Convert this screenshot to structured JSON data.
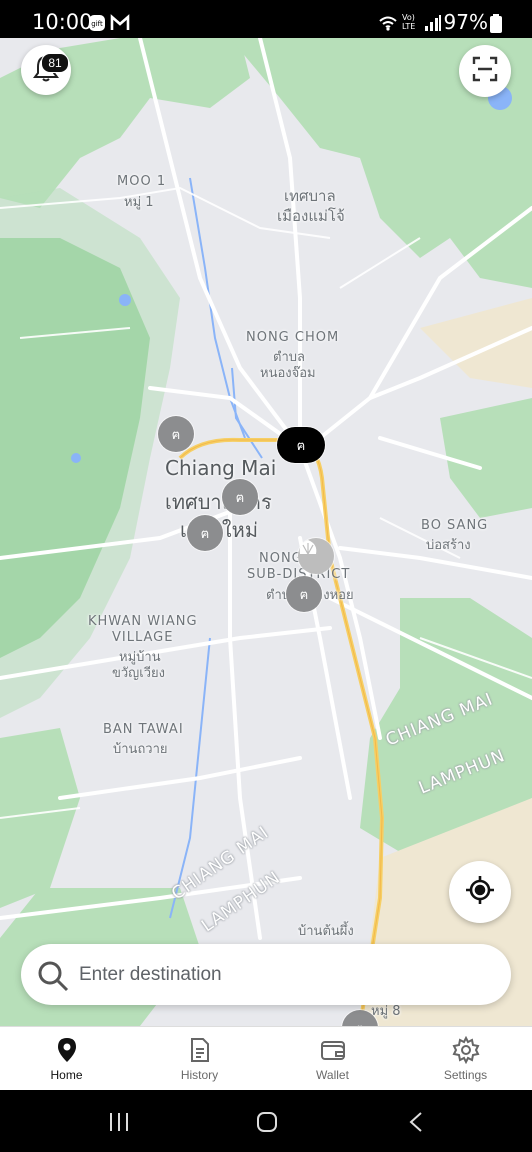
{
  "status_bar": {
    "time": "10:00",
    "right_text": "97%",
    "icons": [
      "gift-icon",
      "gmail-icon",
      "wifi-icon",
      "volte-icon",
      "signal-icon",
      "battery-icon"
    ]
  },
  "map": {
    "labels": {
      "moo1_en": "MOO 1",
      "moo1_th": "หมู่ 1",
      "mae_jo_th1": "เทศบาล",
      "mae_jo_th2": "เมืองแม่โจ้",
      "nong_chom_en": "NONG CHOM",
      "nong_chom_th1": "ตำบล",
      "nong_chom_th2": "หนองจ๊อม",
      "chiang_mai_en": "Chiang Mai",
      "chiang_mai_th1": "เทศบาลนคร",
      "chiang_mai_th2": "เชียงใหม่",
      "bo_sang_en": "BO SANG",
      "bo_sang_th": "บ่อสร้าง",
      "nong_en": "NONG",
      "sub_district_en": "SUB-DISTRICT",
      "nong_th": "ตำบลหนองหอย",
      "khwan_en1": "KHWAN WIANG",
      "khwan_en2": "VILLAGE",
      "khwan_th1": "หมู่บ้าน",
      "khwan_th2": "ขวัญเวียง",
      "ban_tawai_en": "BAN TAWAI",
      "ban_tawai_th": "บ้านถวาย",
      "border_right_1": "CHIANG MAI",
      "border_right_2": "LAMPHUN",
      "border_left_1": "CHIANG MAI",
      "border_left_2": "LAMPHUN",
      "ban_ton_phueng_th": "บ้านต้นผึ้ง",
      "moo8_th": "หมู่ 8"
    },
    "station_glyph": "ฅ"
  },
  "notifications": {
    "count": "81"
  },
  "search": {
    "placeholder": "Enter destination"
  },
  "bottom_nav": [
    {
      "label": "Home",
      "icon": "location-pin-icon",
      "active": true
    },
    {
      "label": "History",
      "icon": "document-icon",
      "active": false
    },
    {
      "label": "Wallet",
      "icon": "wallet-icon",
      "active": false
    },
    {
      "label": "Settings",
      "icon": "gear-icon",
      "active": false
    }
  ],
  "colors": {
    "map_bg": "#e8e9ed",
    "green": "#b7dfb9",
    "dark_green": "#8fcc95",
    "water": "#8ab4f8",
    "highway": "#f6cf65",
    "pin": "#8c8d8f"
  }
}
